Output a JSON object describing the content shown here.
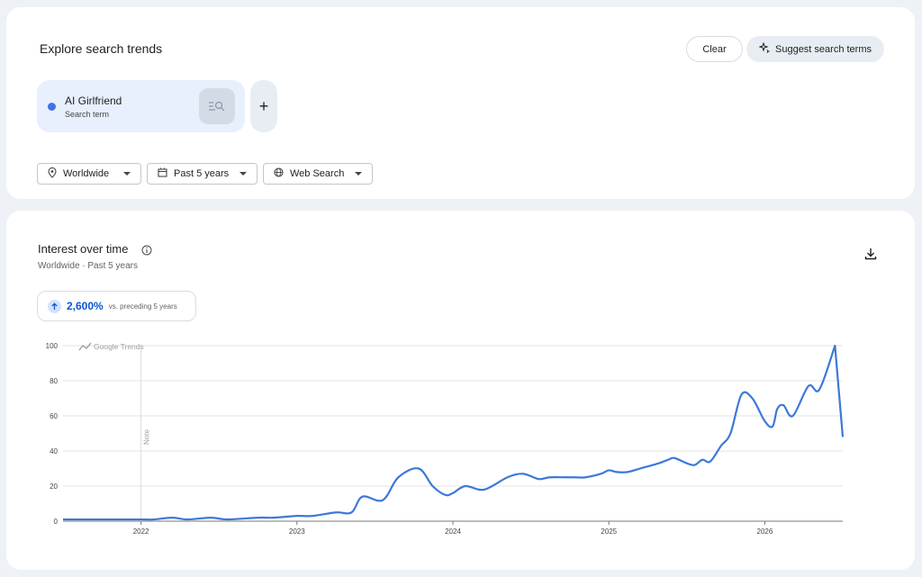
{
  "explore": {
    "title": "Explore search trends",
    "clear_label": "Clear",
    "suggest_label": "Suggest search terms",
    "term": {
      "name": "AI Girlfriend",
      "subtitle": "Search term",
      "color": "#4471e6"
    },
    "add_label": "+",
    "filters": {
      "geo": "Worldwide",
      "time": "Past 5 years",
      "property": "Web Search"
    }
  },
  "interest": {
    "title": "Interest over time",
    "subtitle": "Worldwide · Past 5 years",
    "change_value": "2,600%",
    "change_label": "vs. preceding 5 years",
    "watermark": "Google Trends",
    "note_label": "Note"
  },
  "chart_data": {
    "type": "line",
    "title": "",
    "xlabel": "",
    "ylabel": "",
    "ylim": [
      0,
      100
    ],
    "yticks": [
      0,
      20,
      40,
      60,
      80,
      100
    ],
    "xticks": [
      "2022",
      "2023",
      "2024",
      "2025",
      "2026"
    ],
    "grid": true,
    "color": "#3d78d8",
    "series": [
      {
        "name": "AI Girlfriend",
        "x": [
          2021.5,
          2022.0,
          2022.08,
          2022.2,
          2022.3,
          2022.45,
          2022.55,
          2022.75,
          2022.85,
          2023.0,
          2023.1,
          2023.25,
          2023.35,
          2023.42,
          2023.55,
          2023.65,
          2023.78,
          2023.87,
          2023.95,
          2024.0,
          2024.08,
          2024.2,
          2024.35,
          2024.45,
          2024.55,
          2024.62,
          2024.72,
          2024.78,
          2024.85,
          2024.95,
          2025.0,
          2025.05,
          2025.12,
          2025.2,
          2025.32,
          2025.38,
          2025.42,
          2025.5,
          2025.55,
          2025.6,
          2025.65,
          2025.72,
          2025.78,
          2025.85,
          2025.92,
          2026.0,
          2026.05,
          2026.08,
          2026.12,
          2026.18,
          2026.28,
          2026.35,
          2026.45
        ],
        "values": [
          1,
          1,
          1,
          2,
          1,
          2,
          1,
          2,
          2,
          3,
          3,
          5,
          5,
          14,
          12,
          25,
          30,
          20,
          15,
          16,
          20,
          18,
          25,
          27,
          24,
          25,
          25,
          25,
          25,
          27,
          29,
          28,
          28,
          30,
          33,
          35,
          36,
          33,
          32,
          35,
          34,
          43,
          50,
          72,
          70,
          57,
          54,
          64,
          66,
          60,
          77,
          75,
          100
        ]
      }
    ]
  }
}
